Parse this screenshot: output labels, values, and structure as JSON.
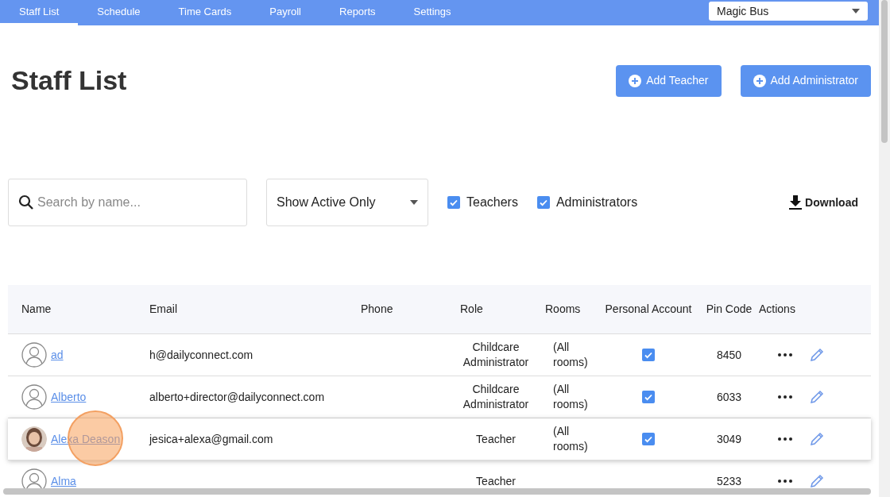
{
  "nav": {
    "tabs": [
      {
        "label": "Staff List",
        "selected": true
      },
      {
        "label": "Schedule",
        "selected": false
      },
      {
        "label": "Time Cards",
        "selected": false
      },
      {
        "label": "Payroll",
        "selected": false
      },
      {
        "label": "Reports",
        "selected": false
      },
      {
        "label": "Settings",
        "selected": false
      }
    ],
    "school_select": "Magic Bus"
  },
  "title": "Staff List",
  "buttons": [
    "Add Teacher",
    "Add Administrator"
  ],
  "filters": {
    "search": {
      "placeholder": "Search by name..."
    },
    "status_select": "Show Active Only",
    "checkboxes": [
      {
        "label": "Teachers",
        "checked": true
      },
      {
        "label": "Administrators",
        "checked": true
      }
    ],
    "download": "Download"
  },
  "table": {
    "columns": [
      "Name",
      "Email",
      "Phone",
      "Role",
      "Rooms",
      "Personal Account",
      "Pin Code",
      "Actions"
    ],
    "rows": [
      {
        "kind": "default",
        "name": "ad",
        "email": "h@dailyconnect.com",
        "role": "Childcare Administrator",
        "rooms": "(All rooms)",
        "personal_account": true,
        "pin": "8450",
        "selected": false
      },
      {
        "kind": "default",
        "name": "Alberto",
        "email": "alberto+director@dailyconnect.com",
        "role": "Childcare Administrator",
        "rooms": "(All rooms)",
        "personal_account": true,
        "pin": "6033",
        "selected": false
      },
      {
        "name": "Alexa Deason",
        "email": "jesica+alexa@gmail.com",
        "role": "Teacher",
        "rooms": "(All rooms)",
        "personal_account": true,
        "pin": "3049",
        "selected": true
      },
      {
        "kind": "default",
        "name": "Alma",
        "role": "Teacher",
        "personal_account": false,
        "pin": "5233",
        "selected": false
      }
    ]
  }
}
